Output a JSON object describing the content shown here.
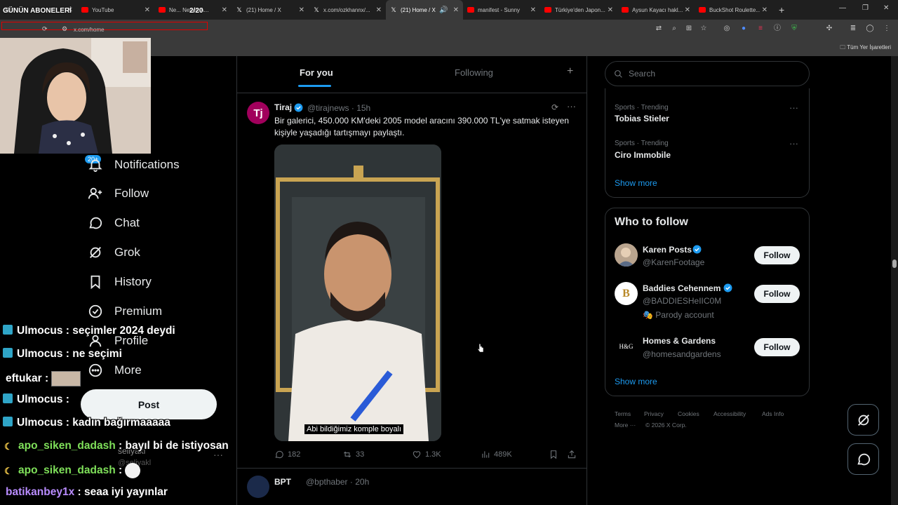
{
  "stream": {
    "channel_title": "GÜNÜN ABONELERİ",
    "count": "2/20"
  },
  "browser": {
    "tabs": [
      {
        "title": "",
        "favicon": "generic",
        "active": false
      },
      {
        "title": "YouTube",
        "favicon": "youtube",
        "active": false
      },
      {
        "title": "Ne... Neden A...",
        "favicon": "youtube",
        "active": false
      },
      {
        "title": "(21) Home / X",
        "favicon": "x",
        "active": false
      },
      {
        "title": "x.com/ozkhannx/...",
        "favicon": "x",
        "active": false
      },
      {
        "title": "(21) Home / X",
        "favicon": "x",
        "active": true
      },
      {
        "title": "manifest - Sunny",
        "favicon": "youtube",
        "active": false
      },
      {
        "title": "Türkiye'den Japon...",
        "favicon": "youtube",
        "active": false
      },
      {
        "title": "Aysun Kayacı hakl...",
        "favicon": "youtube",
        "active": false
      },
      {
        "title": "BuckShot Roulette...",
        "favicon": "youtube",
        "active": false
      }
    ],
    "url": "x.com/home",
    "bookmarks_label": "Tüm Yer İşaretleri"
  },
  "nav": {
    "badge": "20+",
    "items": [
      {
        "label": "Notifications",
        "icon": "bell-icon"
      },
      {
        "label": "Follow",
        "icon": "person-plus-icon"
      },
      {
        "label": "Chat",
        "icon": "chat-bubble-icon"
      },
      {
        "label": "Grok",
        "icon": "grok-icon"
      },
      {
        "label": "History",
        "icon": "bookmark-icon"
      },
      {
        "label": "Premium",
        "icon": "verified-icon"
      },
      {
        "label": "Profile",
        "icon": "person-icon"
      },
      {
        "label": "More",
        "icon": "more-circle-icon"
      }
    ],
    "post_label": "Post",
    "account_name": "seliyakl",
    "account_handle": "@seliyakl"
  },
  "feed": {
    "tabs": [
      "For you",
      "Following"
    ],
    "active_tab": "For you"
  },
  "tweet": {
    "avatar_letter": "Tj",
    "name": "Tiraj",
    "handle": "@tirajnews · 15h",
    "text": "Bir galerici, 450.000 KM'deki 2005 model aracını 390.000 TL'ye satmak isteyen kişiyle yaşadığı tartışmayı paylaştı.",
    "caption": "Abi bildiğimiz komple boyalı",
    "stats": {
      "replies": "182",
      "reposts": "33",
      "likes": "1.3K",
      "views": "489K"
    }
  },
  "next_tweet": {
    "name": "BPT",
    "handle": "@bpthaber · 20h"
  },
  "search": {
    "placeholder": "Search"
  },
  "trends": [
    {
      "category": "Sports · Trending",
      "name": "Tobias Stieler"
    },
    {
      "category": "Sports · Trending",
      "name": "Ciro Immobile"
    }
  ],
  "trends_show_more": "Show more",
  "who_to_follow": {
    "title": "Who to follow",
    "button_label": "Follow",
    "accounts": [
      {
        "name": "Karen Posts",
        "handle": "@KarenFootage",
        "verified": true,
        "extra": ""
      },
      {
        "name": "Baddies Cehennem",
        "handle": "@BADDIESHeIIC0M",
        "verified": true,
        "extra": "Parody account"
      },
      {
        "name": "Homes & Gardens",
        "handle": "@homesandgardens",
        "verified": false,
        "extra": ""
      }
    ],
    "show_more": "Show more"
  },
  "footer": {
    "links": [
      "Terms",
      "Privacy",
      "Cookies",
      "Accessibility",
      "Ads Info"
    ],
    "more": "More ···",
    "copyright": "© 2026 X Corp."
  },
  "chat": [
    {
      "badge": "sub",
      "user": "Ulmocus",
      "message": "seçimler 2024 deydi",
      "color": "white"
    },
    {
      "badge": "sub",
      "user": "Ulmocus",
      "message": "ne seçimi",
      "color": "white"
    },
    {
      "badge": "",
      "user": "eftukar",
      "message": "",
      "color": "white",
      "emote": true
    },
    {
      "badge": "sub",
      "user": "Ulmocus",
      "message": "",
      "color": "white",
      "emote": true
    },
    {
      "badge": "sub",
      "user": "Ulmocus",
      "message": "kadın bağırmaaaaa",
      "color": "white"
    },
    {
      "badge": "moon",
      "user": "apo_siken_dadash",
      "message": "bayıl bi de istiyosan",
      "color": "green"
    },
    {
      "badge": "moon",
      "user": "apo_siken_dadash",
      "message": "",
      "color": "green",
      "emote": true
    },
    {
      "badge": "",
      "user": "batikanbey1x",
      "message": "seaa iyi yayınlar",
      "color": "purple"
    }
  ],
  "colors": {
    "accent": "#1d9bf0",
    "background": "#000000",
    "text": "#e7e9ea",
    "muted": "#71767b",
    "border": "#2f3336"
  }
}
